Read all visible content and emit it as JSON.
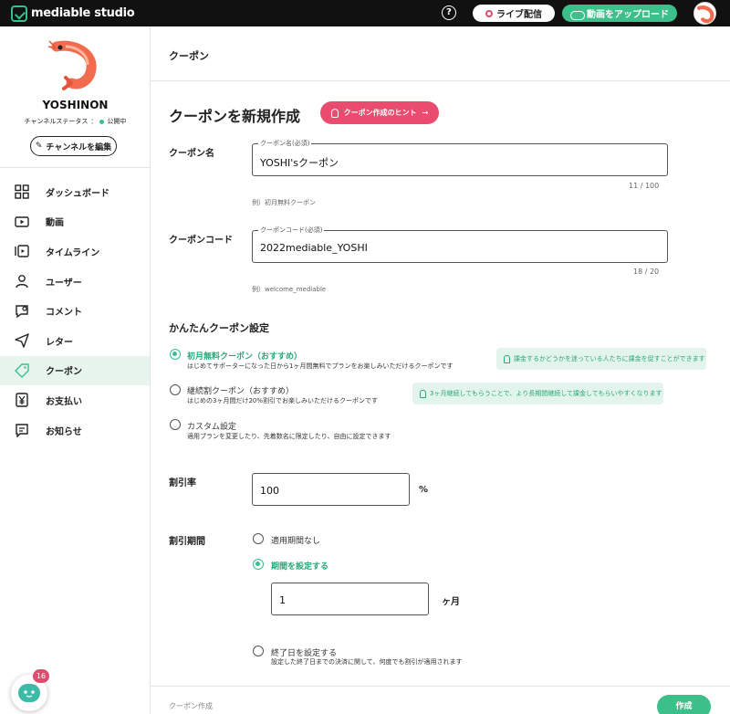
{
  "header": {
    "brand": "mediable studio",
    "help_symbol": "?",
    "live_label": "ライブ配信",
    "upload_label": "動画をアップロード"
  },
  "sidebar": {
    "channel_name": "YOSHINON",
    "status_label": "チャンネルステータス",
    "status_sep": "：",
    "status_value": "公開中",
    "edit_label": "チャンネルを編集",
    "items": [
      {
        "label": "ダッシュボード",
        "icon": "dashboard-icon"
      },
      {
        "label": "動画",
        "icon": "video-icon"
      },
      {
        "label": "タイムライン",
        "icon": "timeline-icon"
      },
      {
        "label": "ユーザー",
        "icon": "user-icon"
      },
      {
        "label": "コメント",
        "icon": "comment-icon"
      },
      {
        "label": "レター",
        "icon": "letter-icon"
      },
      {
        "label": "クーポン",
        "icon": "coupon-icon",
        "active": true
      },
      {
        "label": "お支払い",
        "icon": "payment-icon"
      },
      {
        "label": "お知らせ",
        "icon": "notice-icon"
      }
    ],
    "chat_badge": "16"
  },
  "main": {
    "page_title": "クーポン",
    "section_title": "クーポンを新規作成",
    "hint_label": "クーポン作成のヒント",
    "coupon_name": {
      "label": "クーポン名",
      "legend": "クーポン名(必須)",
      "value": "YOSHI'sクーポン",
      "counter": "11 / 100",
      "example": "例）初月無料クーポン"
    },
    "coupon_code": {
      "label": "クーポンコード",
      "legend": "クーポンコード(必須)",
      "value": "2022mediable_YOSHI",
      "counter": "18 / 20",
      "example": "例）welcome_mediable"
    },
    "easy_settings_title": "かんたんクーポン設定",
    "options": [
      {
        "title": "初月無料クーポン（おすすめ）",
        "desc": "はじめてサポーターになった日から1ヶ月間無料でプランをお楽しみいただけるクーポンです",
        "tip": "課金するかどうかを迷っている人たちに課金を促すことができます",
        "selected": true
      },
      {
        "title": "継続割クーポン（おすすめ）",
        "desc": "はじめの3ヶ月間だけ20%割引でお楽しみいただけるクーポンです",
        "tip": "3ヶ月継続してもらうことで、より長期間継続して課金してもらいやすくなります",
        "selected": false
      },
      {
        "title": "カスタム設定",
        "desc": "適用プランを変更したり、先着数名に限定したり、自由に設定できます",
        "selected": false
      }
    ],
    "discount_rate": {
      "label": "割引率",
      "value": "100",
      "unit": "%"
    },
    "discount_period": {
      "label": "割引期間",
      "opt_none": "適用期間なし",
      "opt_period": "期間を設定する",
      "months_value": "1",
      "months_unit": "ヶ月",
      "opt_end": "終了日を設定する",
      "opt_end_desc": "設定した終了日までの決済に関して、何度でも割引が適用されます"
    },
    "footer_label": "クーポン作成",
    "create_label": "作成"
  },
  "colors": {
    "accent": "#3dbf89",
    "hint": "#e94c6f",
    "header": "#111111"
  }
}
